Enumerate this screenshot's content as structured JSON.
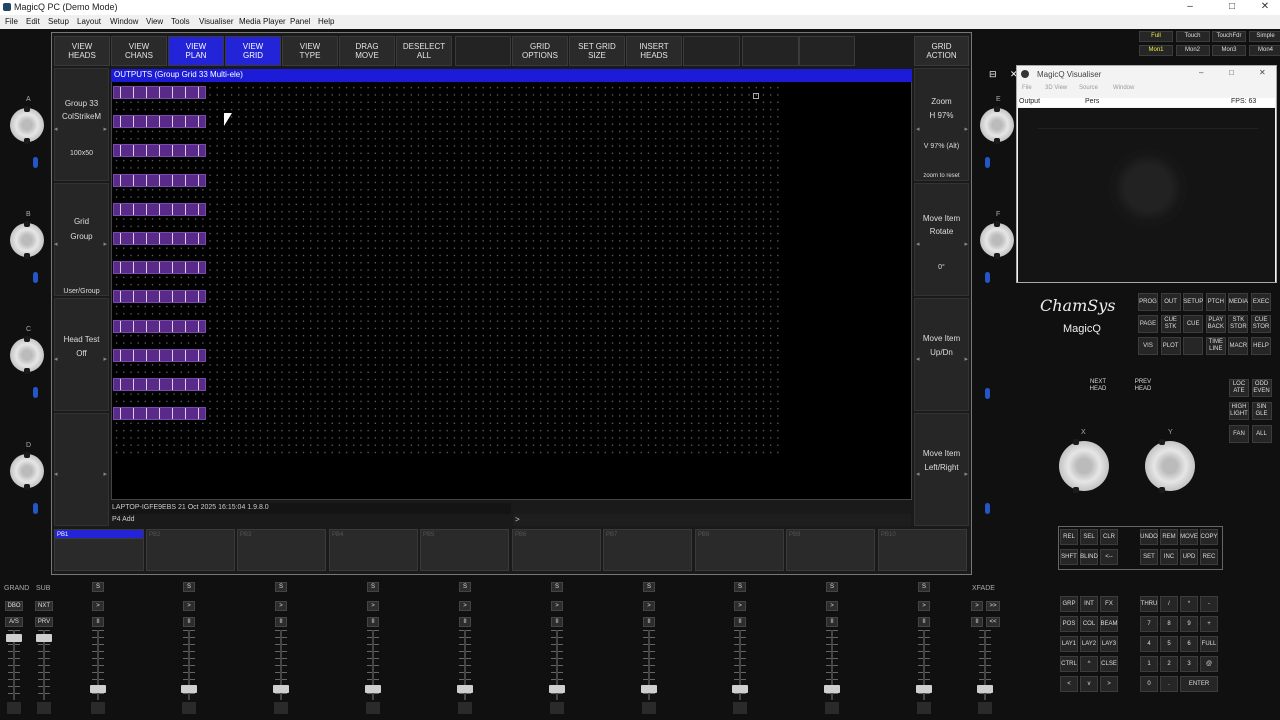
{
  "window": {
    "title": "MagicQ PC (Demo Mode)",
    "controls": [
      "–",
      "□",
      "✕"
    ]
  },
  "menu": [
    "File",
    "Edit",
    "Setup",
    "Layout",
    "Window",
    "View",
    "Tools",
    "Visualiser",
    "Media Player",
    "Panel",
    "Help"
  ],
  "softkeys": [
    {
      "label": "VIEW\nHEADS",
      "on": false
    },
    {
      "label": "VIEW\nCHANS",
      "on": false
    },
    {
      "label": "VIEW\nPLAN",
      "on": true
    },
    {
      "label": "VIEW\nGRID",
      "on": true
    },
    {
      "label": "VIEW\nTYPE",
      "on": false
    },
    {
      "label": "DRAG\nMOVE",
      "on": false
    },
    {
      "label": "DESELECT\nALL",
      "on": false
    },
    {
      "label": "",
      "on": false
    },
    {
      "label": "GRID\nOPTIONS",
      "on": false
    },
    {
      "label": "SET GRID\nSIZE",
      "on": false
    },
    {
      "label": "INSERT\nHEADS",
      "on": false
    },
    {
      "label": "",
      "on": false
    },
    {
      "label": "",
      "on": false
    },
    {
      "label": "",
      "on": false
    },
    {
      "label": "GRID\nACTION",
      "on": false
    }
  ],
  "left_side": {
    "s1": {
      "l1": "Group 33",
      "l2": "ColStrikeM",
      "l3": "100x50"
    },
    "s2": {
      "l1": "Grid",
      "l2": "Group",
      "l3": "User/Group"
    },
    "s3": {
      "l1": "Head Test",
      "l2": "Off"
    }
  },
  "right_side": {
    "s1": {
      "l1": "Zoom",
      "l2": "H 97%",
      "l3": "V 97% (Alt)",
      "l4": "zoom to reset"
    },
    "s2": {
      "l1": "Move Item",
      "l2": "Rotate",
      "l3": "0°"
    },
    "s3": {
      "l1": "Move Item",
      "l2": "Up/Dn"
    },
    "s4": {
      "l1": "Move Item",
      "l2": "Left/Right"
    }
  },
  "outputs": {
    "title": "OUTPUTS (Group Grid 33 Multi-ele)",
    "restore_icon": "⊟",
    "close_icon": "✕"
  },
  "status": {
    "line1": "LAPTOP-IGFE9EBS 21 Oct 2025 16:15:04 1.9.8.0",
    "line2": "P4 Add",
    "cmd": ">"
  },
  "playbacks": [
    "PB1",
    "PB2",
    "PB3",
    "PB4",
    "PB5",
    "PB6",
    "PB7",
    "PB8",
    "PB9",
    "PB10"
  ],
  "encoders_left": [
    "A",
    "B",
    "C",
    "D"
  ],
  "encoders_right": [
    "E",
    "F"
  ],
  "fader_labels": {
    "grand": "GRAND",
    "sub": "SUB",
    "xfade": "XFADE",
    "dbo": "DBO",
    "nxt": "NXT",
    "as": "A/S",
    "prv": "PRV"
  },
  "fader_btns": {
    "s": "S",
    "go": ">",
    "pause": "II",
    "fwd": ">>",
    "back": "<<",
    "bottom": ">"
  },
  "visualiser": {
    "title": "MagicQ Visualiser",
    "menu": [
      "File",
      "3D View",
      "Source",
      "Window"
    ],
    "output": "Output",
    "pers": "Pers",
    "fps": "FPS: 63"
  },
  "view_modes": [
    {
      "label": "Full",
      "yellow": true
    },
    {
      "label": "Touch",
      "yellow": false
    },
    {
      "label": "TouchFdr",
      "yellow": false
    },
    {
      "label": "Simple",
      "yellow": false
    },
    {
      "label": "Mon1",
      "yellow": true
    },
    {
      "label": "Mon2",
      "yellow": false
    },
    {
      "label": "Mon3",
      "yellow": false
    },
    {
      "label": "Mon4",
      "yellow": false
    }
  ],
  "brand": {
    "name": "ChamSys",
    "product": "MagicQ"
  },
  "window_keys": [
    [
      "PROG",
      "OUT",
      "SETUP",
      "PTCH",
      "MEDIA",
      "EXEC"
    ],
    [
      "PAGE",
      "CUE\nSTK",
      "CUE",
      "PLAY\nBACK",
      "STK\nSTOR",
      "CUE\nSTOR"
    ],
    [
      "VIS",
      "PLOT",
      "",
      "TIME\nLINE",
      "MACR",
      "HELP"
    ]
  ],
  "head_keys": {
    "next": "NEXT\nHEAD",
    "prev": "PREV\nHEAD"
  },
  "select_keys": [
    "LOC\nATE",
    "ODD\nEVEN",
    "HIGH\nLIGHT",
    "SIN\nGLE",
    "FAN",
    "ALL"
  ],
  "xy": {
    "x": "X",
    "y": "Y"
  },
  "edit_keys": [
    [
      "REL",
      "SEL",
      "CLR",
      "UNDO",
      "REM",
      "MOVE",
      "COPY"
    ],
    [
      "SHFT",
      "BLIND",
      "<--",
      "SET",
      "INC",
      "UPD",
      "REC"
    ]
  ],
  "numpad": [
    [
      "GRP",
      "INT",
      "FX",
      "THRU",
      "/",
      "*",
      "-"
    ],
    [
      "POS",
      "COL",
      "BEAM",
      "7",
      "8",
      "9",
      "+"
    ],
    [
      "LAY1",
      "LAY2",
      "LAY3",
      "4",
      "5",
      "6",
      "FULL"
    ],
    [
      "CTRL",
      "^",
      "CLSE",
      "1",
      "2",
      "3",
      "@"
    ],
    [
      "<",
      "v",
      ">",
      "0",
      ".",
      "ENTER",
      ""
    ]
  ]
}
